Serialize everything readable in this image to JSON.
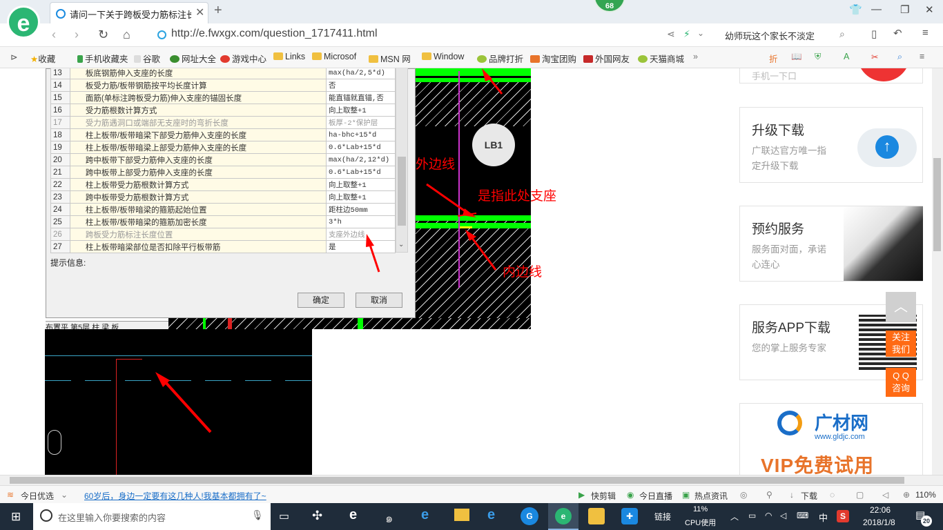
{
  "browser": {
    "tab_title": "请问一下关于跨板受力筋标注长度",
    "badge_count": "68",
    "url": "http://e.fwxgx.com/question_1717411.html",
    "search_text": "幼师玩这个家长不淡定",
    "zoom": "110%"
  },
  "bookmarks": [
    "收藏",
    "手机收藏夹",
    "谷歌",
    "网址大全",
    "游戏中心",
    "Links",
    "Microsof",
    "MSN 网",
    "Window",
    "品牌打折",
    "淘宝团购",
    "外国网友",
    "天猫商城"
  ],
  "dialog": {
    "rows": [
      {
        "num": "13",
        "name": "板底钢筋伸入支座的长度",
        "value": "max(ha/2,5*d)",
        "dim": false
      },
      {
        "num": "14",
        "name": "板受力筋/板带钢筋按平均长度计算",
        "value": "否",
        "dim": false
      },
      {
        "num": "15",
        "name": "面筋(单标注跨板受力筋)伸入支座的锚固长度",
        "value": "能直锚就直锚,否",
        "dim": false
      },
      {
        "num": "16",
        "name": "受力筋根数计算方式",
        "value": "向上取整+1",
        "dim": false
      },
      {
        "num": "17",
        "name": "受力筋遇洞口或端部无支座时的弯折长度",
        "value": "板厚-2*保护层",
        "dim": true
      },
      {
        "num": "18",
        "name": "柱上板带/板带暗梁下部受力筋伸入支座的长度",
        "value": "ha-bhc+15*d",
        "dim": false
      },
      {
        "num": "19",
        "name": "柱上板带/板带暗梁上部受力筋伸入支座的长度",
        "value": "0.6*Lab+15*d",
        "dim": false
      },
      {
        "num": "20",
        "name": "跨中板带下部受力筋伸入支座的长度",
        "value": "max(ha/2,12*d)",
        "dim": false
      },
      {
        "num": "21",
        "name": "跨中板带上部受力筋伸入支座的长度",
        "value": "0.6*Lab+15*d",
        "dim": false
      },
      {
        "num": "22",
        "name": "柱上板带受力筋根数计算方式",
        "value": "向上取整+1",
        "dim": false
      },
      {
        "num": "23",
        "name": "跨中板带受力筋根数计算方式",
        "value": "向上取整+1",
        "dim": false
      },
      {
        "num": "24",
        "name": "柱上板带/板带暗梁的箍筋起始位置",
        "value": "距柱边50mm",
        "dim": false
      },
      {
        "num": "25",
        "name": "柱上板带/板带暗梁的箍筋加密长度",
        "value": "3*h",
        "dim": false
      },
      {
        "num": "26",
        "name": "跨板受力筋标注长度位置",
        "value": "支座外边线",
        "dim": true
      },
      {
        "num": "27",
        "name": "柱上板带暗梁部位是否扣除平行板带筋",
        "value": "是",
        "dim": false
      }
    ],
    "hint_label": "提示信息:",
    "ok_label": "确定",
    "cancel_label": "取消"
  },
  "annotations": {
    "outer_line": "外边线",
    "support": "是指此处支座",
    "inner_line": "内边线",
    "lb1": "LB1"
  },
  "strip_text": "布置平  第5层  柱 梁 板",
  "sidebar": {
    "cards": [
      {
        "title": "升级下载",
        "desc": "广联达官方唯一指定升级下载"
      },
      {
        "title": "预约服务",
        "desc": "服务面对面，承诺心连心"
      },
      {
        "title": "服务APP下载",
        "desc": "您的掌上服务专家"
      }
    ],
    "top_card_partial": "手机一下口",
    "follow_label": "关注\n我们",
    "qq_label": "Q Q\n咨询",
    "ad_logo": "广材网",
    "ad_url": "www.gldjc.com",
    "ad_text": "VIP免费试用"
  },
  "statusbar": {
    "left_label": "今日优选",
    "headline": "60岁后，身边一定要有这几种人!我基本都拥有了~",
    "items": [
      "快剪辑",
      "今日直播",
      "热点资讯",
      "下载"
    ],
    "zoom": "110%"
  },
  "taskbar": {
    "search_placeholder": "在这里输入你要搜索的内容",
    "link_label": "链接",
    "cpu_percent": "11%",
    "cpu_label": "CPU使用",
    "ime": "中",
    "time": "22:06",
    "date": "2018/1/8",
    "notif_count": "20"
  },
  "colors": {
    "cad_green": "#00ff00",
    "annotation_red": "#ff0000",
    "accent_orange": "#ff6a13",
    "brand_green": "#2bb673"
  }
}
